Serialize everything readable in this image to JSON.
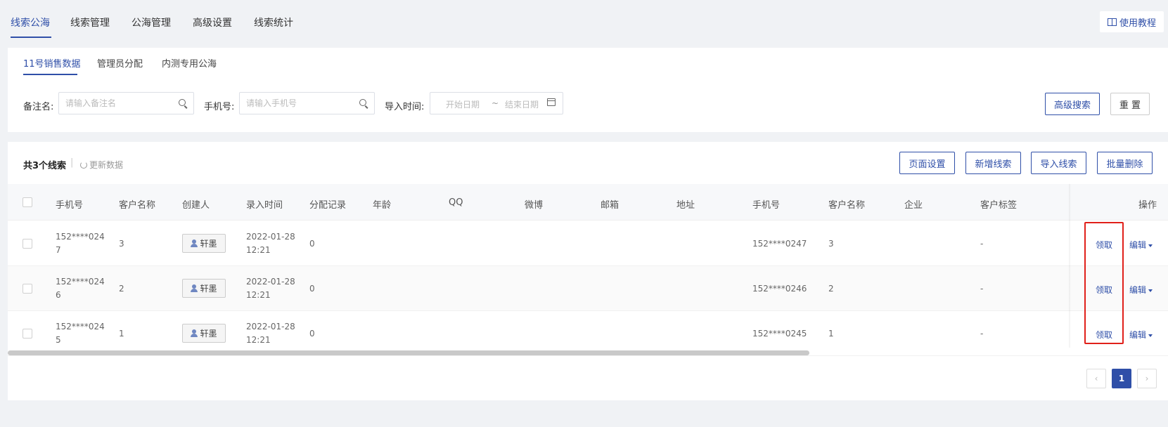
{
  "top_nav": {
    "tabs": [
      "线索公海",
      "管理",
      "公海管理",
      "高级设置",
      "线索统计"
    ],
    "tutorial": "使用教程"
  },
  "sub_tabs": [
    "11号销售数据",
    "管理员分配",
    "内测专用公海"
  ],
  "filters": {
    "remark_label": "备注名:",
    "remark_placeholder": "请输入备注名",
    "phone_label": "手机号:",
    "phone_placeholder": "请输入手机号",
    "import_time_label": "导入时间:",
    "start_date": "开始日期",
    "range_sep": "~",
    "end_date": "结束日期",
    "advanced_search": "高级搜索",
    "reset": "重 置"
  },
  "summary": {
    "total": "共3个线索",
    "separator": "|",
    "refresh": "更新数据"
  },
  "actions": [
    "页面设置",
    "新增线索",
    "导入线索",
    "批量删除"
  ],
  "table": {
    "columns": [
      "手机号",
      "客户名称",
      "创建人",
      "录入时间",
      "分配记录",
      "年龄",
      "QQ",
      "微博",
      "邮箱",
      "地址",
      "手机号",
      "客户名称",
      "企业",
      "客户标签",
      "操作"
    ],
    "rows": [
      {
        "phone_a": "152****024",
        "phone_b": "7",
        "name": "3",
        "creator": "轩墨",
        "date": "2022-01-28",
        "time": "12:21",
        "assign": "0",
        "phone_full": "152****0247",
        "name2": "3",
        "tag": "-",
        "claim": "领取",
        "edit": "编辑"
      },
      {
        "phone_a": "152****024",
        "phone_b": "6",
        "name": "2",
        "creator": "轩墨",
        "date": "2022-01-28",
        "time": "12:21",
        "assign": "0",
        "phone_full": "152****0246",
        "name2": "2",
        "tag": "-",
        "claim": "领取",
        "edit": "编辑"
      },
      {
        "phone_a": "152****024",
        "phone_b": "5",
        "name": "1",
        "creator": "轩墨",
        "date": "2022-01-28",
        "time": "12:21",
        "assign": "0",
        "phone_full": "152****0245",
        "name2": "1",
        "tag": "-",
        "claim": "领取",
        "edit": "编辑"
      }
    ]
  },
  "pagination": {
    "prev": "‹",
    "current": "1",
    "next": "›"
  },
  "colors": {
    "accent": "#2f4fa8",
    "highlight": "#e0201a"
  }
}
